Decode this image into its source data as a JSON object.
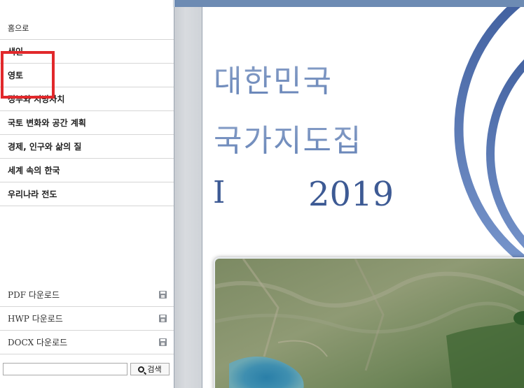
{
  "sidebar": {
    "nav": [
      {
        "label": "홈으로"
      },
      {
        "label": "색인"
      },
      {
        "label": "영토"
      },
      {
        "label": "정부와 지방자치"
      },
      {
        "label": "국토 변화와 공간 계획"
      },
      {
        "label": "경제, 인구와 삶의 질"
      },
      {
        "label": "세계 속의 한국"
      },
      {
        "label": "우리나라 전도"
      }
    ],
    "downloads": [
      {
        "label": "PDF 다운로드",
        "icon": "floppy-disk-icon"
      },
      {
        "label": "HWP 다운로드",
        "icon": "floppy-disk-icon"
      },
      {
        "label": "DOCX 다운로드",
        "icon": "floppy-disk-icon"
      }
    ],
    "search": {
      "value": "",
      "button_label": "검색"
    }
  },
  "document": {
    "title_line1": "대한민국",
    "title_line2": "국가지도집",
    "volume": "I",
    "year": "2019"
  },
  "colors": {
    "accent_bar": "#6d8bb3",
    "title_blue": "#6583b7",
    "highlight_red": "#e1282b"
  }
}
